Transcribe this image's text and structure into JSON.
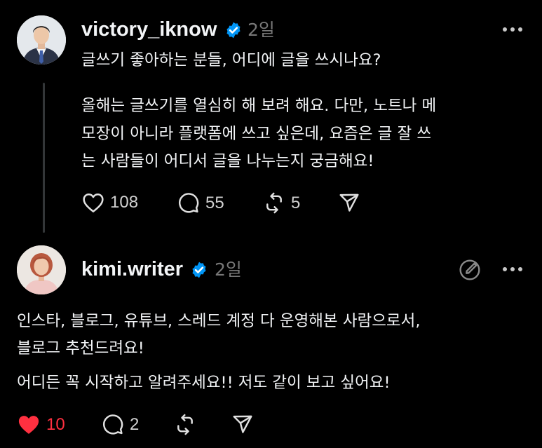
{
  "post": {
    "username": "victory_iknow",
    "verified": true,
    "time": "2일",
    "title_line": "글쓰기 좋아하는 분들, 어디에 글을 쓰시나요?",
    "body_lines": [
      "올해는 글쓰기를 열심히 해 보려 해요. 다만, 노트나 메",
      "모장이 아니라 플랫폼에 쓰고 싶은데, 요즘은 글 잘 쓰",
      "는 사람들이 어디서 글을 나누는지 궁금해요!"
    ],
    "actions": {
      "likes": "108",
      "comments": "55",
      "reposts": "5"
    },
    "icons": [
      "heart-icon",
      "comment-icon",
      "repost-icon",
      "share-icon",
      "more-icon",
      "verified-badge-icon"
    ]
  },
  "reply": {
    "username": "kimi.writer",
    "verified": true,
    "time": "2일",
    "lines": [
      "인스타, 블로그, 유튜브, 스레드 계정 다 운영해본 사람으로서,",
      "블로그 추천드려요!",
      "어디든 꼭 시작하고 알려주세요!! 저도 같이 보고 싶어요!"
    ],
    "actions": {
      "likes": "10",
      "liked": true,
      "comments": "2"
    },
    "icons": [
      "heart-filled-icon",
      "comment-icon",
      "repost-icon",
      "share-icon",
      "edit-icon",
      "more-icon"
    ]
  },
  "colors": {
    "background": "#000000",
    "text": "#f3f5f7",
    "muted": "#777777",
    "verified": "#0095f6",
    "like": "#ff3040",
    "thread_line": "#333638"
  }
}
